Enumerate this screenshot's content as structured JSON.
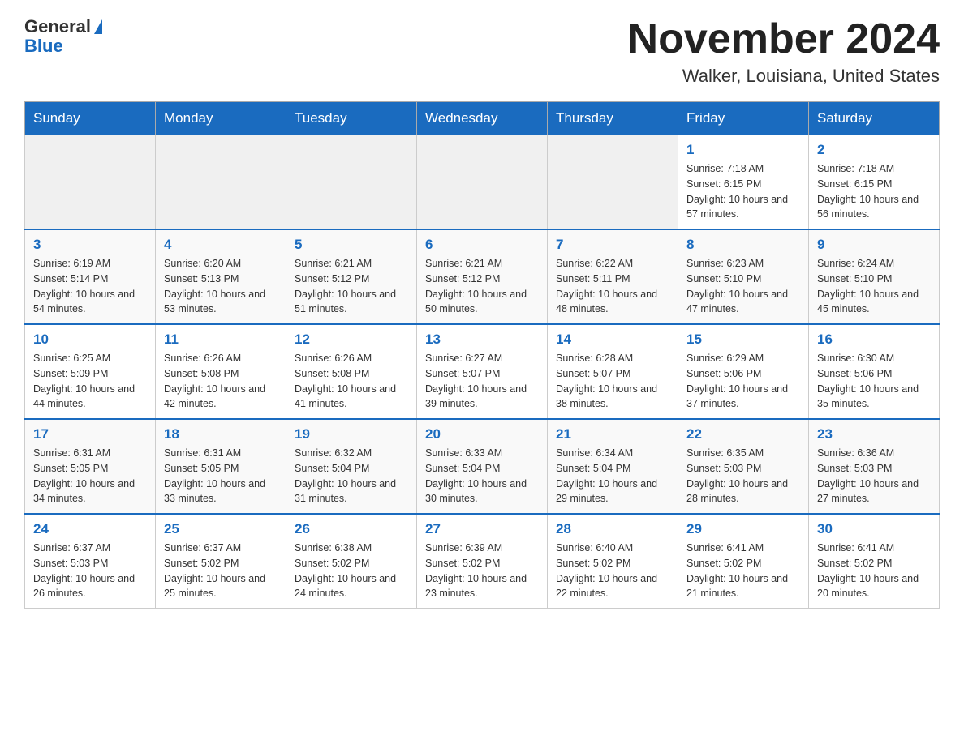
{
  "header": {
    "logo_general": "General",
    "logo_blue": "Blue",
    "month_title": "November 2024",
    "location": "Walker, Louisiana, United States"
  },
  "days_of_week": [
    "Sunday",
    "Monday",
    "Tuesday",
    "Wednesday",
    "Thursday",
    "Friday",
    "Saturday"
  ],
  "weeks": [
    [
      {
        "day": "",
        "info": ""
      },
      {
        "day": "",
        "info": ""
      },
      {
        "day": "",
        "info": ""
      },
      {
        "day": "",
        "info": ""
      },
      {
        "day": "",
        "info": ""
      },
      {
        "day": "1",
        "info": "Sunrise: 7:18 AM\nSunset: 6:15 PM\nDaylight: 10 hours and 57 minutes."
      },
      {
        "day": "2",
        "info": "Sunrise: 7:18 AM\nSunset: 6:15 PM\nDaylight: 10 hours and 56 minutes."
      }
    ],
    [
      {
        "day": "3",
        "info": "Sunrise: 6:19 AM\nSunset: 5:14 PM\nDaylight: 10 hours and 54 minutes."
      },
      {
        "day": "4",
        "info": "Sunrise: 6:20 AM\nSunset: 5:13 PM\nDaylight: 10 hours and 53 minutes."
      },
      {
        "day": "5",
        "info": "Sunrise: 6:21 AM\nSunset: 5:12 PM\nDaylight: 10 hours and 51 minutes."
      },
      {
        "day": "6",
        "info": "Sunrise: 6:21 AM\nSunset: 5:12 PM\nDaylight: 10 hours and 50 minutes."
      },
      {
        "day": "7",
        "info": "Sunrise: 6:22 AM\nSunset: 5:11 PM\nDaylight: 10 hours and 48 minutes."
      },
      {
        "day": "8",
        "info": "Sunrise: 6:23 AM\nSunset: 5:10 PM\nDaylight: 10 hours and 47 minutes."
      },
      {
        "day": "9",
        "info": "Sunrise: 6:24 AM\nSunset: 5:10 PM\nDaylight: 10 hours and 45 minutes."
      }
    ],
    [
      {
        "day": "10",
        "info": "Sunrise: 6:25 AM\nSunset: 5:09 PM\nDaylight: 10 hours and 44 minutes."
      },
      {
        "day": "11",
        "info": "Sunrise: 6:26 AM\nSunset: 5:08 PM\nDaylight: 10 hours and 42 minutes."
      },
      {
        "day": "12",
        "info": "Sunrise: 6:26 AM\nSunset: 5:08 PM\nDaylight: 10 hours and 41 minutes."
      },
      {
        "day": "13",
        "info": "Sunrise: 6:27 AM\nSunset: 5:07 PM\nDaylight: 10 hours and 39 minutes."
      },
      {
        "day": "14",
        "info": "Sunrise: 6:28 AM\nSunset: 5:07 PM\nDaylight: 10 hours and 38 minutes."
      },
      {
        "day": "15",
        "info": "Sunrise: 6:29 AM\nSunset: 5:06 PM\nDaylight: 10 hours and 37 minutes."
      },
      {
        "day": "16",
        "info": "Sunrise: 6:30 AM\nSunset: 5:06 PM\nDaylight: 10 hours and 35 minutes."
      }
    ],
    [
      {
        "day": "17",
        "info": "Sunrise: 6:31 AM\nSunset: 5:05 PM\nDaylight: 10 hours and 34 minutes."
      },
      {
        "day": "18",
        "info": "Sunrise: 6:31 AM\nSunset: 5:05 PM\nDaylight: 10 hours and 33 minutes."
      },
      {
        "day": "19",
        "info": "Sunrise: 6:32 AM\nSunset: 5:04 PM\nDaylight: 10 hours and 31 minutes."
      },
      {
        "day": "20",
        "info": "Sunrise: 6:33 AM\nSunset: 5:04 PM\nDaylight: 10 hours and 30 minutes."
      },
      {
        "day": "21",
        "info": "Sunrise: 6:34 AM\nSunset: 5:04 PM\nDaylight: 10 hours and 29 minutes."
      },
      {
        "day": "22",
        "info": "Sunrise: 6:35 AM\nSunset: 5:03 PM\nDaylight: 10 hours and 28 minutes."
      },
      {
        "day": "23",
        "info": "Sunrise: 6:36 AM\nSunset: 5:03 PM\nDaylight: 10 hours and 27 minutes."
      }
    ],
    [
      {
        "day": "24",
        "info": "Sunrise: 6:37 AM\nSunset: 5:03 PM\nDaylight: 10 hours and 26 minutes."
      },
      {
        "day": "25",
        "info": "Sunrise: 6:37 AM\nSunset: 5:02 PM\nDaylight: 10 hours and 25 minutes."
      },
      {
        "day": "26",
        "info": "Sunrise: 6:38 AM\nSunset: 5:02 PM\nDaylight: 10 hours and 24 minutes."
      },
      {
        "day": "27",
        "info": "Sunrise: 6:39 AM\nSunset: 5:02 PM\nDaylight: 10 hours and 23 minutes."
      },
      {
        "day": "28",
        "info": "Sunrise: 6:40 AM\nSunset: 5:02 PM\nDaylight: 10 hours and 22 minutes."
      },
      {
        "day": "29",
        "info": "Sunrise: 6:41 AM\nSunset: 5:02 PM\nDaylight: 10 hours and 21 minutes."
      },
      {
        "day": "30",
        "info": "Sunrise: 6:41 AM\nSunset: 5:02 PM\nDaylight: 10 hours and 20 minutes."
      }
    ]
  ]
}
